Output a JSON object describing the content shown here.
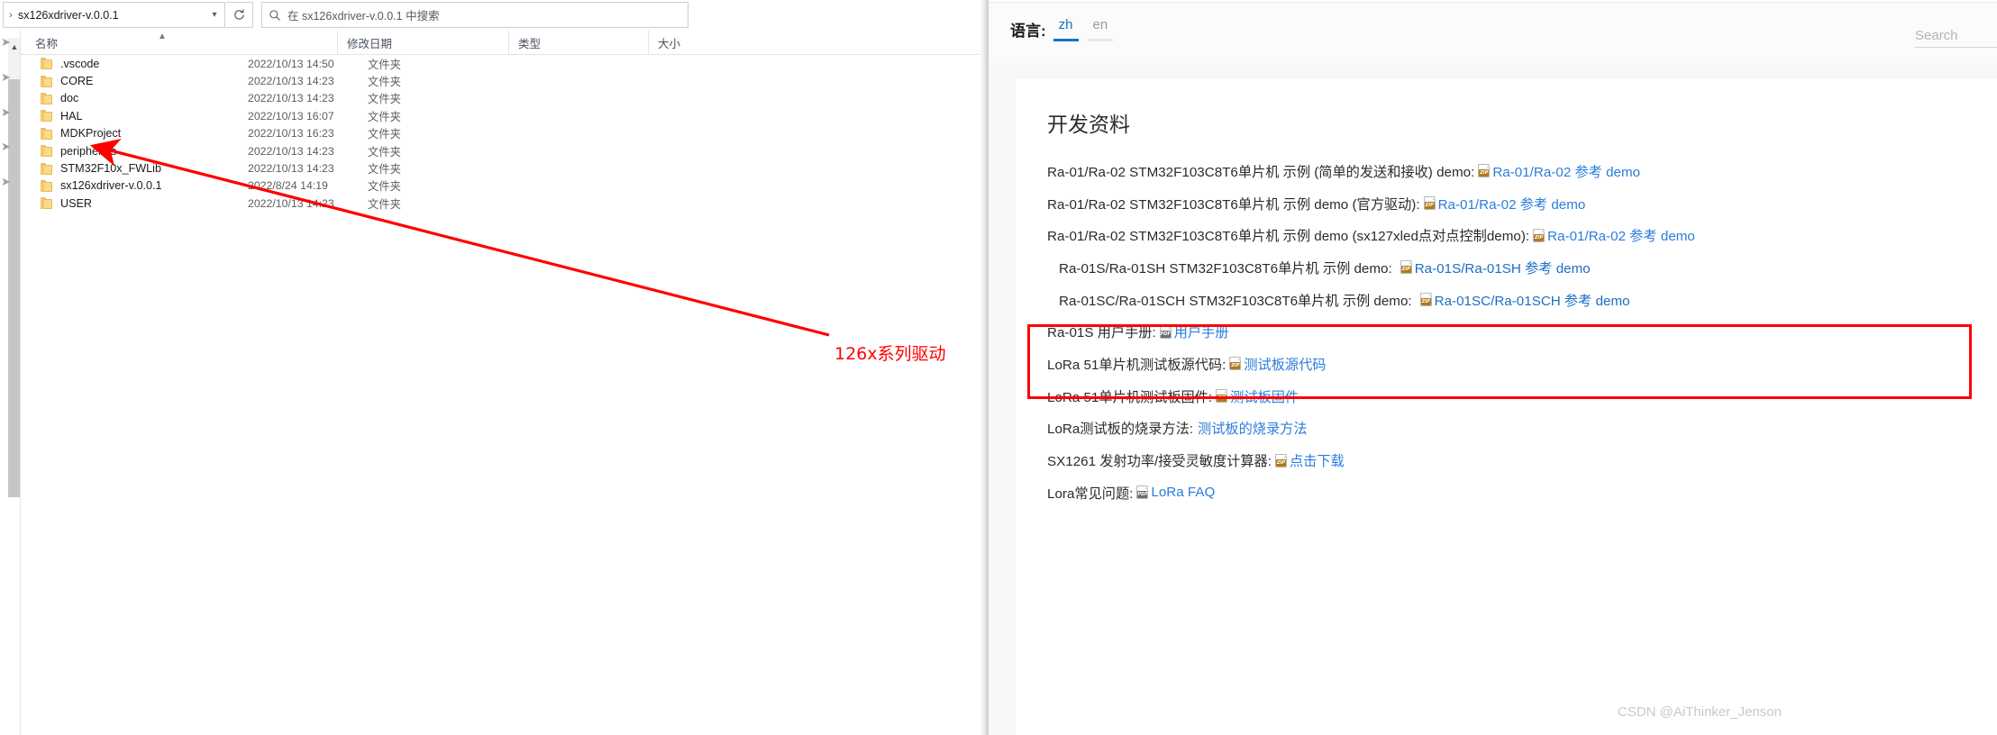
{
  "explorer": {
    "address": {
      "chevron_icon": "chevron-right-icon",
      "path": "sx126xdriver-v.0.0.1",
      "dropdown_icon": "chevron-down-icon"
    },
    "refresh_icon": "refresh-icon",
    "search": {
      "icon": "search-icon",
      "placeholder": "在 sx126xdriver-v.0.0.1 中搜索"
    },
    "columns": [
      {
        "label": "名称",
        "sorted": true,
        "sort_icon": "caret-up-icon"
      },
      {
        "label": "修改日期",
        "sorted": false
      },
      {
        "label": "类型",
        "sorted": false
      },
      {
        "label": "大小",
        "sorted": false
      }
    ],
    "rows": [
      {
        "icon": "folder-icon",
        "name": ".vscode",
        "date": "2022/10/13 14:50",
        "type": "文件夹",
        "size": ""
      },
      {
        "icon": "folder-icon",
        "name": "CORE",
        "date": "2022/10/13 14:23",
        "type": "文件夹",
        "size": ""
      },
      {
        "icon": "folder-icon",
        "name": "doc",
        "date": "2022/10/13 14:23",
        "type": "文件夹",
        "size": ""
      },
      {
        "icon": "folder-icon",
        "name": "HAL",
        "date": "2022/10/13 16:07",
        "type": "文件夹",
        "size": ""
      },
      {
        "icon": "folder-icon",
        "name": "MDKProject",
        "date": "2022/10/13 16:23",
        "type": "文件夹",
        "size": ""
      },
      {
        "icon": "folder-icon",
        "name": "peripherals",
        "date": "2022/10/13 14:23",
        "type": "文件夹",
        "size": ""
      },
      {
        "icon": "folder-icon",
        "name": "STM32F10x_FWLib",
        "date": "2022/10/13 14:23",
        "type": "文件夹",
        "size": ""
      },
      {
        "icon": "folder-icon",
        "name": "sx126xdriver-v.0.0.1",
        "date": "2022/8/24 14:19",
        "type": "文件夹",
        "size": ""
      },
      {
        "icon": "folder-icon",
        "name": "USER",
        "date": "2022/10/13 14:23",
        "type": "文件夹",
        "size": ""
      }
    ],
    "annotation": {
      "label": "126x系列驱动",
      "color": "#ff0000",
      "arrow_icon": "arrow-left-annotation-icon"
    },
    "nav_rail": {
      "pin_icon": "pin-icon",
      "pin_count": 5,
      "scroll_up_icon": "caret-up-icon"
    }
  },
  "webpage": {
    "header": {
      "language_label": "语言:",
      "languages": [
        {
          "code": "zh",
          "active": true
        },
        {
          "code": "en",
          "active": false
        }
      ],
      "search_placeholder": "Search",
      "search_value": "",
      "icons": [
        {
          "name": "user-icon"
        },
        {
          "name": "gear-icon"
        },
        {
          "name": "logout-icon"
        }
      ]
    },
    "card": {
      "title": "开发资料",
      "accent_link_color": "#2a7ddc",
      "highlight_color": "#ff0000",
      "entries": [
        {
          "lead": "Ra-01/Ra-02 STM32F103C8T6单片机 示例 (简单的发送和接收) demo:",
          "file_icon": "zip-file-icon",
          "file_type": "ZIP",
          "link": "Ra-01/Ra-02 参考 demo",
          "highlighted": false
        },
        {
          "lead": "Ra-01/Ra-02 STM32F103C8T6单片机 示例 demo (官方驱动):",
          "file_icon": "zip-file-icon",
          "file_type": "ZIP",
          "link": "Ra-01/Ra-02 参考 demo",
          "highlighted": false
        },
        {
          "lead": "Ra-01/Ra-02 STM32F103C8T6单片机 示例 demo (sx127xled点对点控制demo):",
          "file_icon": "zip-file-icon",
          "file_type": "ZIP",
          "link": "Ra-01/Ra-02 参考 demo",
          "highlighted": false
        },
        {
          "lead": "Ra-01S/Ra-01SH STM32F103C8T6单片机 示例 demo:",
          "file_icon": "zip-file-icon",
          "file_type": "ZIP",
          "link": "Ra-01S/Ra-01SH 参考 demo",
          "highlighted": true
        },
        {
          "lead": "Ra-01SC/Ra-01SCH STM32F103C8T6单片机 示例 demo:",
          "file_icon": "zip-file-icon",
          "file_type": "ZIP",
          "link": "Ra-01SC/Ra-01SCH 参考 demo",
          "highlighted": true
        },
        {
          "lead": "Ra-01S 用户手册:",
          "file_icon": "pdf-file-icon",
          "file_type": "PDF",
          "link": "用户手册",
          "highlighted": false
        },
        {
          "lead": "LoRa 51单片机测试板源代码:",
          "file_icon": "zip-file-icon",
          "file_type": "ZIP",
          "link": "测试板源代码",
          "highlighted": false
        },
        {
          "lead": "LoRa 51单片机测试板固件:",
          "file_icon": "zip-file-icon",
          "file_type": "ZIP",
          "link": "测试板固件",
          "highlighted": false
        },
        {
          "lead": "LoRa测试板的烧录方法:",
          "file_icon": "",
          "file_type": "",
          "link": "测试板的烧录方法",
          "highlighted": false
        },
        {
          "lead": "SX1261 发射功率/接受灵敏度计算器:",
          "file_icon": "zip-file-icon",
          "file_type": "ZIP",
          "link": "点击下载",
          "highlighted": false
        },
        {
          "lead": "Lora常见问题:",
          "file_icon": "pdf-file-icon",
          "file_type": "PDF",
          "link": "LoRa FAQ",
          "highlighted": false
        }
      ]
    }
  },
  "watermark": "CSDN @AiThinker_Jenson"
}
